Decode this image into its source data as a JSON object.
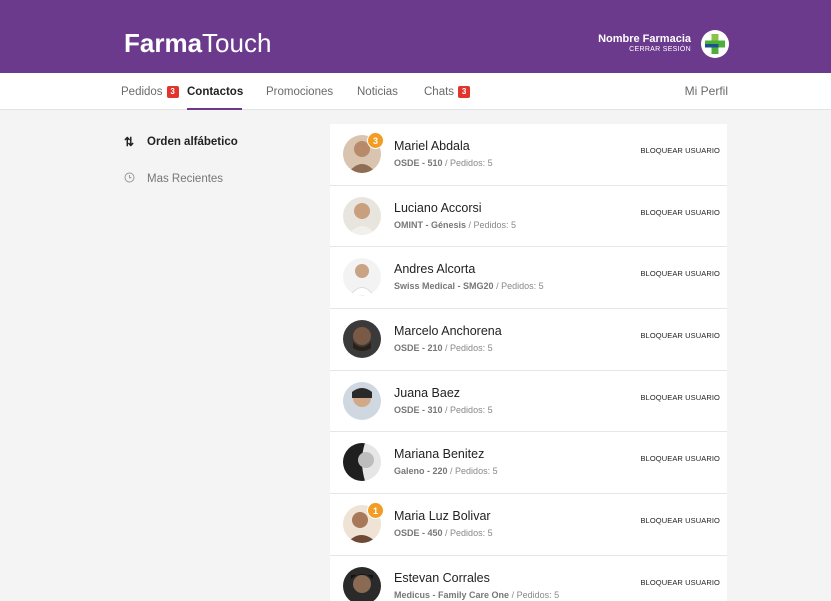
{
  "header": {
    "brand_bold": "Farma",
    "brand_rest": "Touch",
    "pharmacy_name": "Nombre Farmacia",
    "logout_label": "CERRAR SESIÓN",
    "accent_color": "#6b3a8c"
  },
  "nav": {
    "tabs": [
      {
        "label": "Pedidos",
        "badge": "3"
      },
      {
        "label": "Contactos",
        "badge": ""
      },
      {
        "label": "Promociones",
        "badge": ""
      },
      {
        "label": "Noticias",
        "badge": ""
      },
      {
        "label": "Chats",
        "badge": "3"
      }
    ],
    "active_tab": "Contactos",
    "profile_label": "Mi Perfil"
  },
  "sort": {
    "alphabetical_label": "Orden alfábetico",
    "recent_label": "Mas Recientes",
    "alphabetical_icon": "sort-arrows-icon",
    "recent_icon": "clock-icon"
  },
  "contacts": [
    {
      "name": "Mariel Abdala",
      "plan": "OSDE - 510",
      "orders": "/ Pedidos: 5",
      "unread": "3",
      "action": "BLOQUEAR USUARIO"
    },
    {
      "name": "Luciano Accorsi",
      "plan": "OMINT - Génesis",
      "orders": "/ Pedidos: 5",
      "unread": "",
      "action": "BLOQUEAR USUARIO"
    },
    {
      "name": "Andres Alcorta",
      "plan": "Swiss Medical - SMG20",
      "orders": "/ Pedidos: 5",
      "unread": "",
      "action": "BLOQUEAR USUARIO"
    },
    {
      "name": "Marcelo Anchorena",
      "plan": "OSDE - 210",
      "orders": "/ Pedidos: 5",
      "unread": "",
      "action": "BLOQUEAR USUARIO"
    },
    {
      "name": "Juana Baez",
      "plan": "OSDE - 310",
      "orders": "/ Pedidos: 5",
      "unread": "",
      "action": "BLOQUEAR USUARIO"
    },
    {
      "name": "Mariana Benitez",
      "plan": "Galeno - 220",
      "orders": "/ Pedidos: 5",
      "unread": "",
      "action": "BLOQUEAR USUARIO"
    },
    {
      "name": "Maria Luz Bolivar",
      "plan": "OSDE - 450",
      "orders": "/ Pedidos: 5",
      "unread": "1",
      "action": "BLOQUEAR USUARIO"
    },
    {
      "name": "Estevan Corrales",
      "plan": "Medicus - Family Care One",
      "orders": "/ Pedidos: 5",
      "unread": "",
      "action": "BLOQUEAR USUARIO"
    }
  ]
}
